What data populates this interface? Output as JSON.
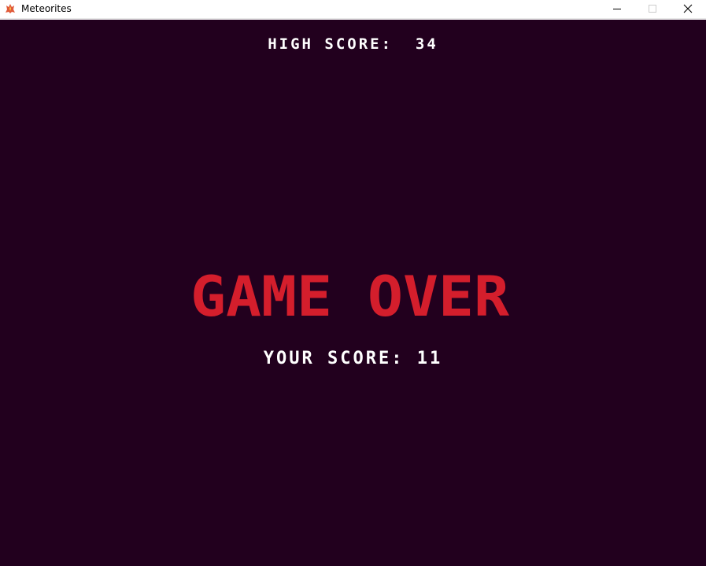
{
  "window": {
    "title": "Meteorites",
    "icon": "meteorites-app-icon"
  },
  "controls": {
    "minimize_icon": "minimize-icon",
    "maximize_icon": "maximize-icon",
    "close_icon": "close-icon"
  },
  "game": {
    "high_score": "HIGH SCORE:  34",
    "game_over": "GAME OVER",
    "your_score": "YOUR SCORE: 11"
  },
  "colors": {
    "background": "#22001e",
    "game_over_text": "#d41e2c",
    "score_text": "#ffffff"
  }
}
